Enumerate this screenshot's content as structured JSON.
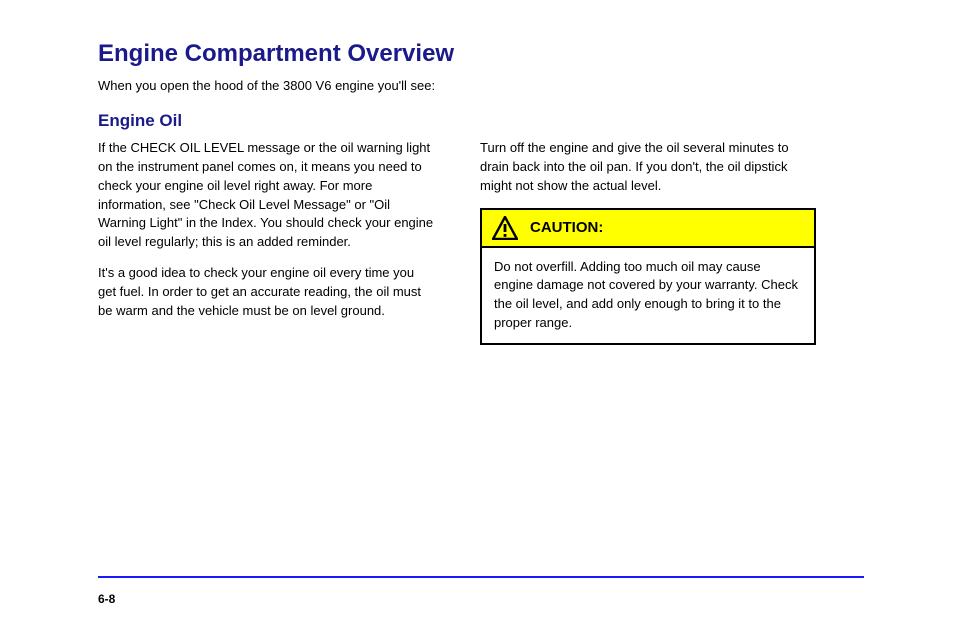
{
  "heading1": "Engine Compartment Overview",
  "lead": "When you open the hood of the 3800 V6 engine you'll see:",
  "heading2": "Engine Oil",
  "left": {
    "p1": "If the CHECK OIL LEVEL message or the oil warning light on the instrument panel comes on, it means you need to check your engine oil level right away. For more information, see \"Check Oil Level Message\" or \"Oil Warning Light\" in the Index. You should check your engine oil level regularly; this is an added reminder.",
    "p2": "It's a good idea to check your engine oil every time you get fuel. In order to get an accurate reading, the oil must be warm and the vehicle must be on level ground."
  },
  "right": {
    "p1": "Turn off the engine and give the oil several minutes to drain back into the oil pan. If you don't, the oil dipstick might not show the actual level."
  },
  "caution": {
    "title": "CAUTION:",
    "body": "Do not overfill. Adding too much oil may cause engine damage not covered by your warranty. Check the oil level, and add only enough to bring it to the proper range."
  },
  "page": "6-8"
}
